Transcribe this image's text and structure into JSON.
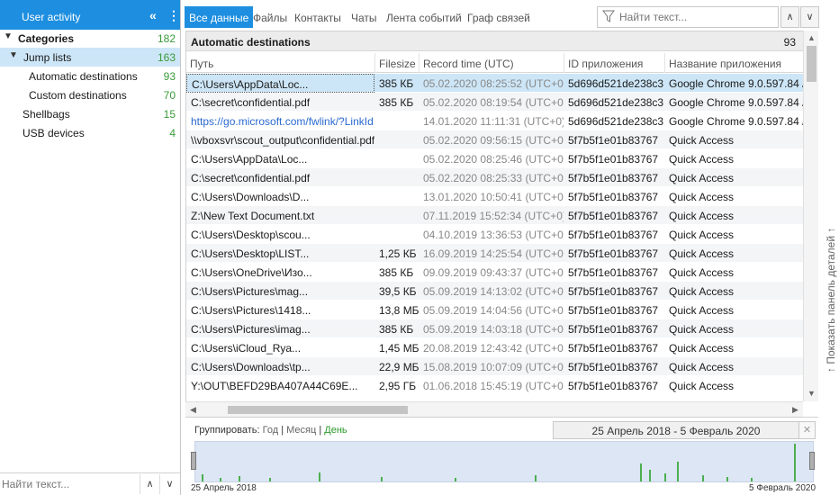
{
  "sidebar": {
    "header_title": "User activity",
    "collapse_glyph": "«",
    "menu_glyph": "⋮",
    "items": [
      {
        "label": "Categories",
        "count": "182"
      },
      {
        "label": "Jump lists",
        "count": "163"
      },
      {
        "label": "Automatic destinations",
        "count": "93"
      },
      {
        "label": "Custom destinations",
        "count": "70"
      },
      {
        "label": "Shellbags",
        "count": "15"
      },
      {
        "label": "USB devices",
        "count": "4"
      }
    ],
    "search_placeholder": "Найти текст..."
  },
  "tabs": [
    "Все данные",
    "Файлы",
    "Контакты",
    "Чаты",
    "Лента событий",
    "Граф связей"
  ],
  "search": {
    "placeholder": "Найти текст..."
  },
  "group": {
    "label": "Automatic destinations",
    "count": "93"
  },
  "columns": [
    "Путь",
    "Filesize",
    "Record time (UTC)",
    "ID приложения",
    "Название приложения"
  ],
  "rows": [
    {
      "path": "C:\\Users\\AppData\\Loc...",
      "size": "385 КБ",
      "time": "05.02.2020 08:25:52 (UTC+0)",
      "appid": "5d696d521de238c3",
      "app": "Google Chrome 9.0.597.84 / 12"
    },
    {
      "path": "C:\\secret\\confidential.pdf",
      "size": "385 КБ",
      "time": "05.02.2020 08:19:54 (UTC+0)",
      "appid": "5d696d521de238c3",
      "app": "Google Chrome 9.0.597.84 / 12"
    },
    {
      "path": "https://go.microsoft.com/fwlink/?LinkId...",
      "size": "",
      "time": "14.01.2020 11:11:31 (UTC+0)",
      "appid": "5d696d521de238c3",
      "app": "Google Chrome 9.0.597.84 / 12"
    },
    {
      "path": "\\\\vboxsvr\\scout_output\\confidential.pdf",
      "size": "",
      "time": "05.02.2020 09:56:15 (UTC+0)",
      "appid": "5f7b5f1e01b83767",
      "app": "Quick Access"
    },
    {
      "path": "C:\\Users\\AppData\\Loc...",
      "size": "",
      "time": "05.02.2020 08:25:46 (UTC+0)",
      "appid": "5f7b5f1e01b83767",
      "app": "Quick Access"
    },
    {
      "path": "C:\\secret\\confidential.pdf",
      "size": "",
      "time": "05.02.2020 08:25:33 (UTC+0)",
      "appid": "5f7b5f1e01b83767",
      "app": "Quick Access"
    },
    {
      "path": "C:\\Users\\Downloads\\D...",
      "size": "",
      "time": "13.01.2020 10:50:41 (UTC+0)",
      "appid": "5f7b5f1e01b83767",
      "app": "Quick Access"
    },
    {
      "path": "Z:\\New Text Document.txt",
      "size": "",
      "time": "07.11.2019 15:52:34 (UTC+0)",
      "appid": "5f7b5f1e01b83767",
      "app": "Quick Access"
    },
    {
      "path": "C:\\Users\\Desktop\\scou...",
      "size": "",
      "time": "04.10.2019 13:36:53 (UTC+0)",
      "appid": "5f7b5f1e01b83767",
      "app": "Quick Access"
    },
    {
      "path": "C:\\Users\\Desktop\\LIST...",
      "size": "1,25 КБ",
      "time": "16.09.2019 14:25:54 (UTC+0)",
      "appid": "5f7b5f1e01b83767",
      "app": "Quick Access"
    },
    {
      "path": "C:\\Users\\OneDrive\\Изо...",
      "size": "385 КБ",
      "time": "09.09.2019 09:43:37 (UTC+0)",
      "appid": "5f7b5f1e01b83767",
      "app": "Quick Access"
    },
    {
      "path": "C:\\Users\\Pictures\\mag...",
      "size": "39,5 КБ",
      "time": "05.09.2019 14:13:02 (UTC+0)",
      "appid": "5f7b5f1e01b83767",
      "app": "Quick Access"
    },
    {
      "path": "C:\\Users\\Pictures\\1418...",
      "size": "13,8 МБ",
      "time": "05.09.2019 14:04:56 (UTC+0)",
      "appid": "5f7b5f1e01b83767",
      "app": "Quick Access"
    },
    {
      "path": "C:\\Users\\Pictures\\imag...",
      "size": "385 КБ",
      "time": "05.09.2019 14:03:18 (UTC+0)",
      "appid": "5f7b5f1e01b83767",
      "app": "Quick Access"
    },
    {
      "path": "C:\\Users\\iCloud_Rya...",
      "size": "1,45 МБ",
      "time": "20.08.2019 12:43:42 (UTC+0)",
      "appid": "5f7b5f1e01b83767",
      "app": "Quick Access"
    },
    {
      "path": "C:\\Users\\Downloads\\tp...",
      "size": "22,9 МБ",
      "time": "15.08.2019 10:07:09 (UTC+0)",
      "appid": "5f7b5f1e01b83767",
      "app": "Quick Access"
    },
    {
      "path": "Y:\\OUT\\BEFD29BA407A44C69E...",
      "size": "2,95 ГБ",
      "time": "01.06.2018 15:45:19 (UTC+0)",
      "appid": "5f7b5f1e01b83767",
      "app": "Quick Access"
    }
  ],
  "side_panel_label": "↑ Показать панель деталей ↑",
  "timeline": {
    "group_label": "Группировать:",
    "options": [
      "Год",
      "Месяц",
      "День"
    ],
    "active_option": "День",
    "range_text": "25 Апрель 2018 - 5 Февраль 2020",
    "start_label": "25 Апрель 2018",
    "end_label": "5 Февраль 2020",
    "bars": [
      0.18,
      0.1,
      0.14,
      0.08,
      0.22,
      0.12,
      0.1,
      0.16,
      0.45,
      0.3,
      0.2,
      0.5,
      0.15,
      0.12,
      0.1,
      0.95
    ]
  },
  "colors": {
    "accent": "#1e8fe0",
    "selection": "#cde6f7",
    "count_green": "#3a9a3a",
    "bar_green": "#4caf50"
  }
}
